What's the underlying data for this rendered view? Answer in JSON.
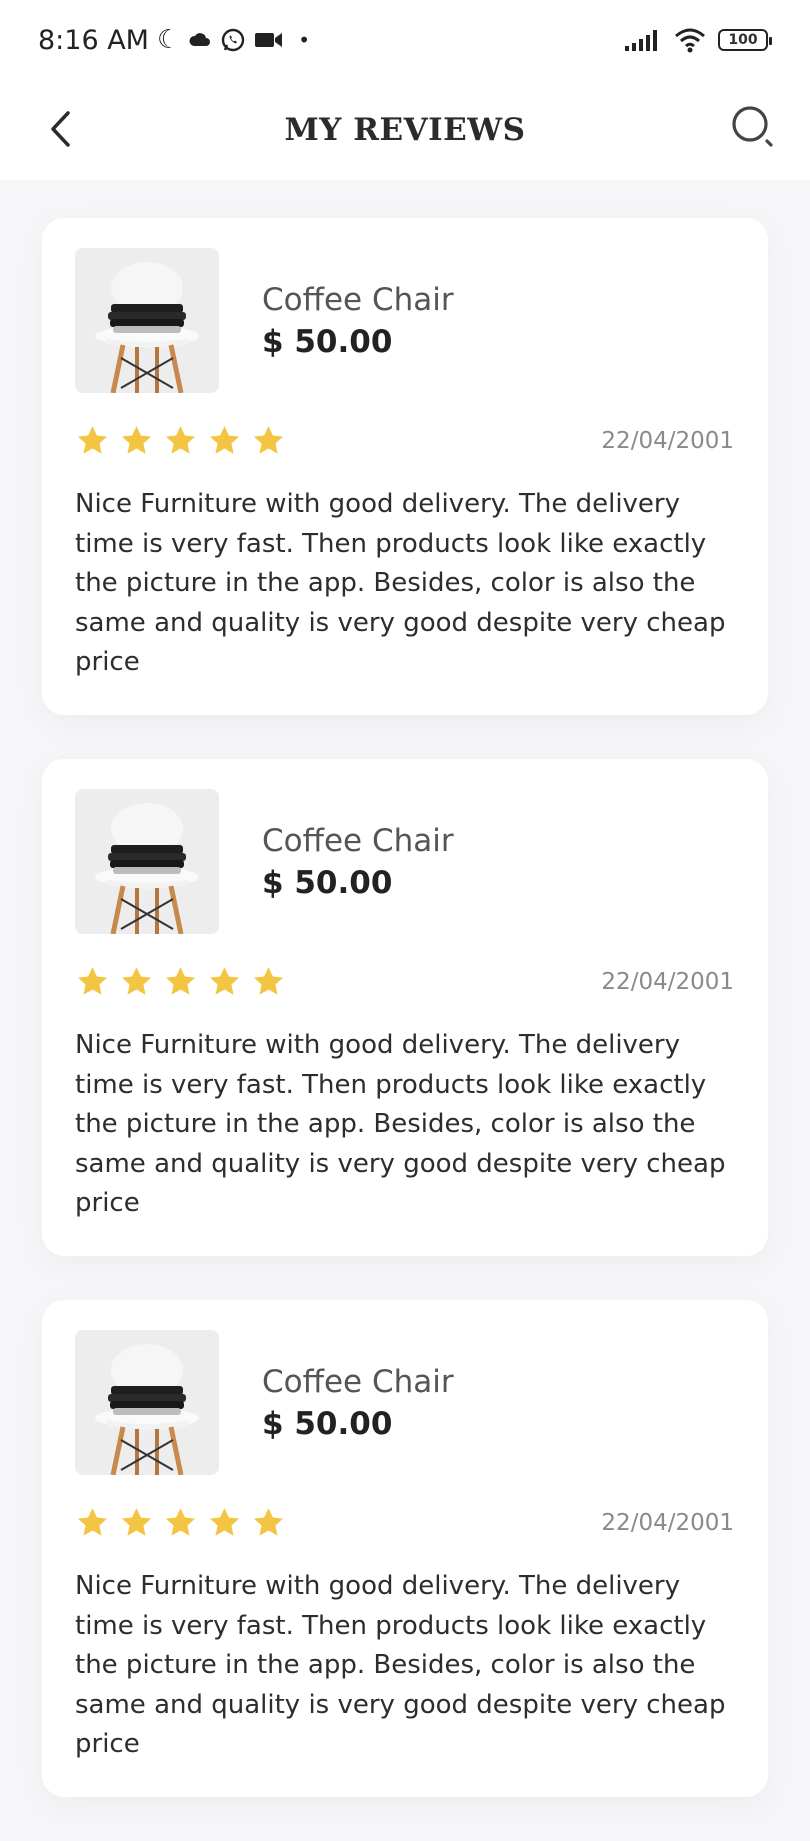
{
  "status_bar": {
    "time": "8:16 AM",
    "battery": "100",
    "icons": [
      "moon-icon",
      "cloud-icon",
      "whatsapp-icon",
      "video-icon",
      "dot-icon",
      "signal-icon",
      "wifi-icon",
      "battery-icon"
    ]
  },
  "header": {
    "title": "MY REVIEWS",
    "back_icon": "chevron-left-icon",
    "search_icon": "search-icon"
  },
  "colors": {
    "star": "#F4C542",
    "card_bg": "#FFFFFF",
    "page_bg": "#F6F6F8"
  },
  "reviews": [
    {
      "product_name": "Coffee Chair",
      "price": "$ 50.00",
      "rating": 5,
      "date": "22/04/2001",
      "text": "Nice Furniture with good delivery. The delivery time is very fast. Then products look like exactly the picture in the app. Besides, color is also the same and quality is very good despite very cheap price"
    },
    {
      "product_name": "Coffee Chair",
      "price": "$ 50.00",
      "rating": 5,
      "date": "22/04/2001",
      "text": "Nice Furniture with good delivery. The delivery time is very fast. Then products look like exactly the picture in the app. Besides, color is also the same and quality is very good despite very cheap price"
    },
    {
      "product_name": "Coffee Chair",
      "price": "$ 50.00",
      "rating": 5,
      "date": "22/04/2001",
      "text": "Nice Furniture with good delivery. The delivery time is very fast. Then products look like exactly the picture in the app. Besides, color is also the same and quality is very good despite very cheap price"
    }
  ]
}
